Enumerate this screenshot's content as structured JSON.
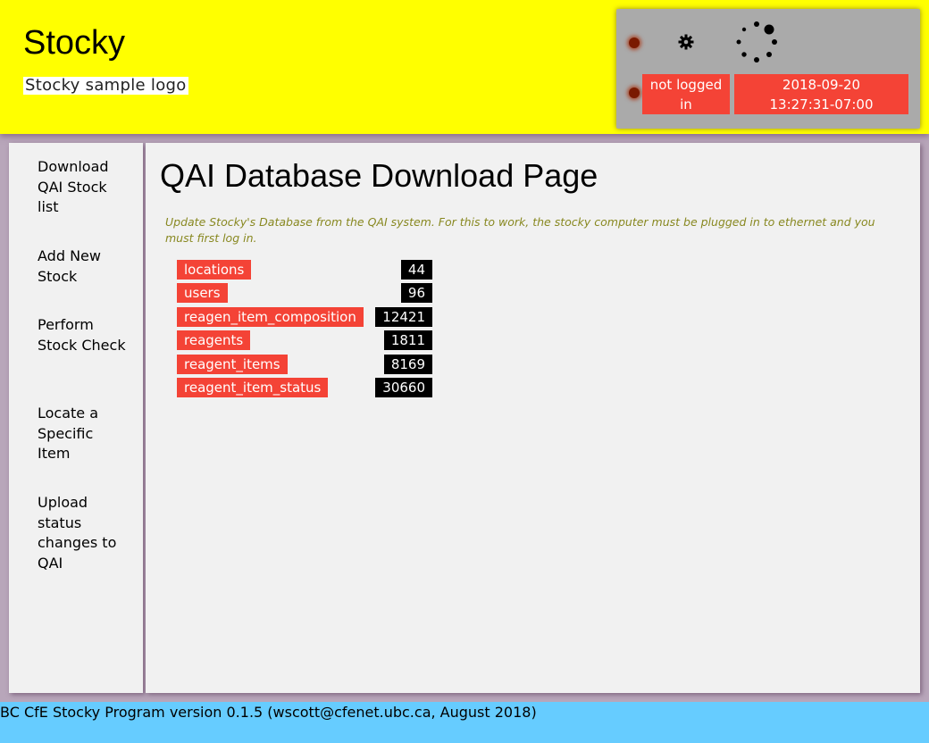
{
  "header": {
    "title": "Stocky",
    "logo_alt": "Stocky sample logo"
  },
  "status": {
    "login_line1": "not logged",
    "login_line2": "in",
    "date": "2018-09-20",
    "time": "13:27:31-07:00",
    "led_color": "#7a1a00",
    "icons": [
      "led-icon",
      "gear-icon",
      "loading-spinner-icon"
    ]
  },
  "sidebar": {
    "items": [
      {
        "label": "Download QAI Stock list"
      },
      {
        "label": "Add New Stock"
      },
      {
        "label": "Perform Stock Check"
      },
      {
        "label": "Locate a Specific Item"
      },
      {
        "label": "Upload status changes to QAI"
      }
    ]
  },
  "main": {
    "title": "QAI Database Download Page",
    "description": "Update Stocky's Database from the QAI system. For this to work, the stocky computer must be plugged in to ethernet and you must first log in.",
    "tables": [
      {
        "name": "locations",
        "count": "44"
      },
      {
        "name": "users",
        "count": "96"
      },
      {
        "name": "reagen_item_composition",
        "count": "12421"
      },
      {
        "name": "reagents",
        "count": "1811"
      },
      {
        "name": "reagent_items",
        "count": "8169"
      },
      {
        "name": "reagent_item_status",
        "count": "30660"
      }
    ]
  },
  "footer": {
    "text": "BC CfE Stocky Program version 0.1.5 (wscott@cfenet.ubc.ca, August 2018)"
  },
  "colors": {
    "header_bg": "#ffff00",
    "accent_red": "#f44336",
    "footer_bg": "#66ccff",
    "panel_bg": "#f1f1f1",
    "description_text": "#888820"
  }
}
